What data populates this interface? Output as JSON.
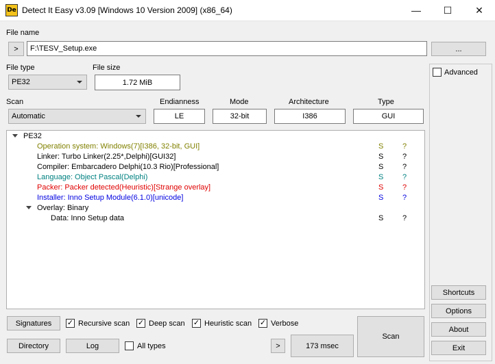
{
  "window": {
    "title": "Detect It Easy v3.09 [Windows 10 Version 2009] (x86_64)",
    "icon_text": "De",
    "minimize": "—",
    "maximize": "☐",
    "close": "✕"
  },
  "file": {
    "label": "File name",
    "open_button": ">",
    "path": "F:\\TESV_Setup.exe",
    "browse_button": "..."
  },
  "file_type": {
    "label": "File type",
    "value": "PE32"
  },
  "file_size": {
    "label": "File size",
    "value": "1.72 MiB"
  },
  "scan": {
    "label": "Scan",
    "value": "Automatic"
  },
  "info": {
    "endianness": {
      "label": "Endianness",
      "value": "LE"
    },
    "mode": {
      "label": "Mode",
      "value": "32-bit"
    },
    "architecture": {
      "label": "Architecture",
      "value": "I386"
    },
    "type": {
      "label": "Type",
      "value": "GUI"
    }
  },
  "advanced": {
    "label": "Advanced",
    "checked": false
  },
  "results": {
    "root": "PE32",
    "items": [
      {
        "text": "Operation system: Windows(7)[I386, 32-bit, GUI]",
        "color": "#808000",
        "s": "S",
        "q": "?"
      },
      {
        "text": "Linker: Turbo Linker(2.25*,Delphi)[GUI32]",
        "color": "#000000",
        "s": "S",
        "q": "?"
      },
      {
        "text": "Compiler: Embarcadero Delphi(10.3 Rio)[Professional]",
        "color": "#000000",
        "s": "S",
        "q": "?"
      },
      {
        "text": "Language: Object Pascal(Delphi)",
        "color": "#008080",
        "s": "S",
        "q": "?"
      },
      {
        "text": "Packer: Packer detected(Heuristic)[Strange overlay]",
        "color": "#e00000",
        "s": "S",
        "q": "?"
      },
      {
        "text": "Installer: Inno Setup Module(6.1.0)[unicode]",
        "color": "#0000e0",
        "s": "S",
        "q": "?"
      }
    ],
    "overlay": "Overlay: Binary",
    "overlay_child": {
      "text": "Data: Inno Setup data",
      "color": "#000000",
      "s": "S",
      "q": "?"
    }
  },
  "bottom": {
    "signatures": "Signatures",
    "recursive_scan": "Recursive scan",
    "deep_scan": "Deep scan",
    "heuristic_scan": "Heuristic scan",
    "verbose": "Verbose",
    "directory": "Directory",
    "log": "Log",
    "all_types": "All types",
    "more": ">",
    "time": "173 msec",
    "scan": "Scan",
    "check_mark": "✓"
  },
  "side": {
    "shortcuts": "Shortcuts",
    "options": "Options",
    "about": "About",
    "exit": "Exit"
  }
}
